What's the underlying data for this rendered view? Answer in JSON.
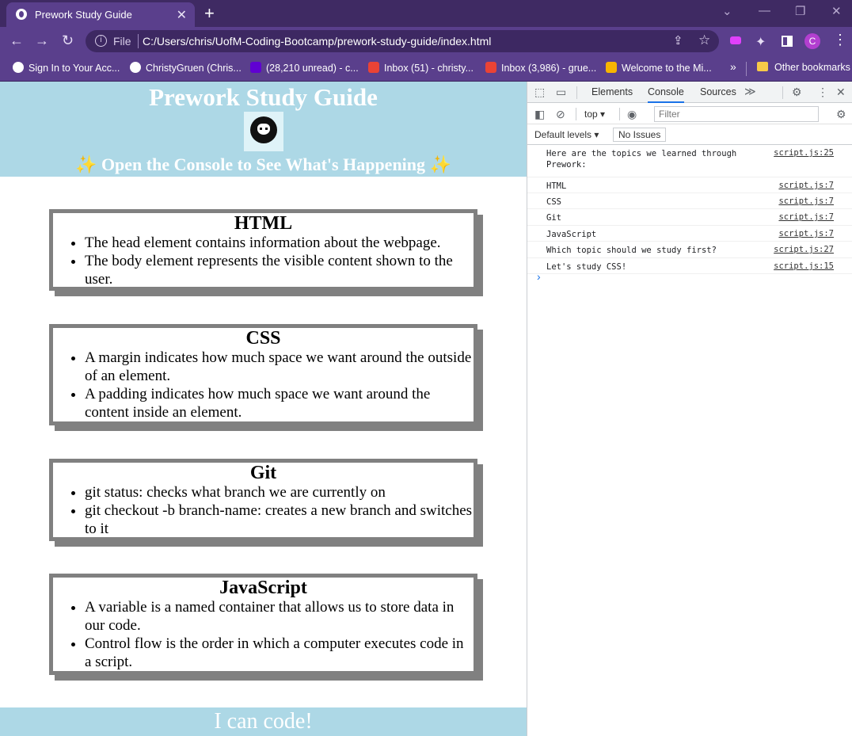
{
  "browser": {
    "tab_title": "Prework Study Guide",
    "tab_close": "✕",
    "new_tab": "+",
    "window_controls": [
      "⌄",
      "—",
      "❐",
      "✕"
    ],
    "nav": {
      "back": "←",
      "forward": "→",
      "reload": "↻"
    },
    "address": {
      "info": "i",
      "scheme_label": "File",
      "url": "C:/Users/chris/UofM-Coding-Bootcamp/prework-study-guide/index.html",
      "share": "⇪",
      "star": "☆"
    },
    "profile_initial": "C",
    "menu": "⋮",
    "bookmarks": [
      {
        "label": "Sign In to Your Acc...",
        "color": "#ffffff"
      },
      {
        "label": "ChristyGruen (Chris...",
        "color": "#ffffff"
      },
      {
        "label": "(28,210 unread) - c...",
        "color": "#6001d2"
      },
      {
        "label": "Inbox (51) - christy...",
        "color": "#ea4335"
      },
      {
        "label": "Inbox (3,986) - grue...",
        "color": "#ea4335"
      },
      {
        "label": "Welcome to the Mi...",
        "color": "#f7b500"
      }
    ],
    "bookmarks_more": "»",
    "other_bookmarks": "Other bookmarks"
  },
  "page": {
    "title": "Prework Study Guide",
    "subtitle": "✨ Open the Console to See What's Happening ✨",
    "sections": [
      {
        "heading": "HTML",
        "items": [
          "The head element contains information about the webpage.",
          "The body element represents the visible content shown to the user."
        ]
      },
      {
        "heading": "CSS",
        "items": [
          "A margin indicates how much space we want around the outside of an element.",
          "A padding indicates how much space we want around the content inside an element."
        ]
      },
      {
        "heading": "Git",
        "items": [
          "git status: checks what branch we are currently on",
          "git checkout -b branch-name: creates a new branch and switches to it"
        ]
      },
      {
        "heading": "JavaScript",
        "items": [
          "A variable is a named container that allows us to store data in our code.",
          "Control flow is the order in which a computer executes code in a script."
        ]
      }
    ],
    "footer": "I can code!"
  },
  "devtools": {
    "tabs": [
      "Elements",
      "Console",
      "Sources"
    ],
    "active_tab": "Console",
    "more_tabs": "≫",
    "context": "top",
    "filter_placeholder": "Filter",
    "levels": "Default levels ▾",
    "issues": "No Issues",
    "logs": [
      {
        "message": "Here are the topics we learned through\nPrework:",
        "source": "script.js:25"
      },
      {
        "message": "HTML",
        "source": "script.js:7"
      },
      {
        "message": "CSS",
        "source": "script.js:7"
      },
      {
        "message": "Git",
        "source": "script.js:7"
      },
      {
        "message": "JavaScript",
        "source": "script.js:7"
      },
      {
        "message": "Which topic should we study first?",
        "source": "script.js:27"
      },
      {
        "message": "Let's study CSS!",
        "source": "script.js:15"
      }
    ],
    "prompt": "›"
  },
  "colors": {
    "chrome": "#5a3f8c",
    "tabbar": "#3f2a63",
    "header": "#add8e6",
    "card_border": "#808080"
  }
}
